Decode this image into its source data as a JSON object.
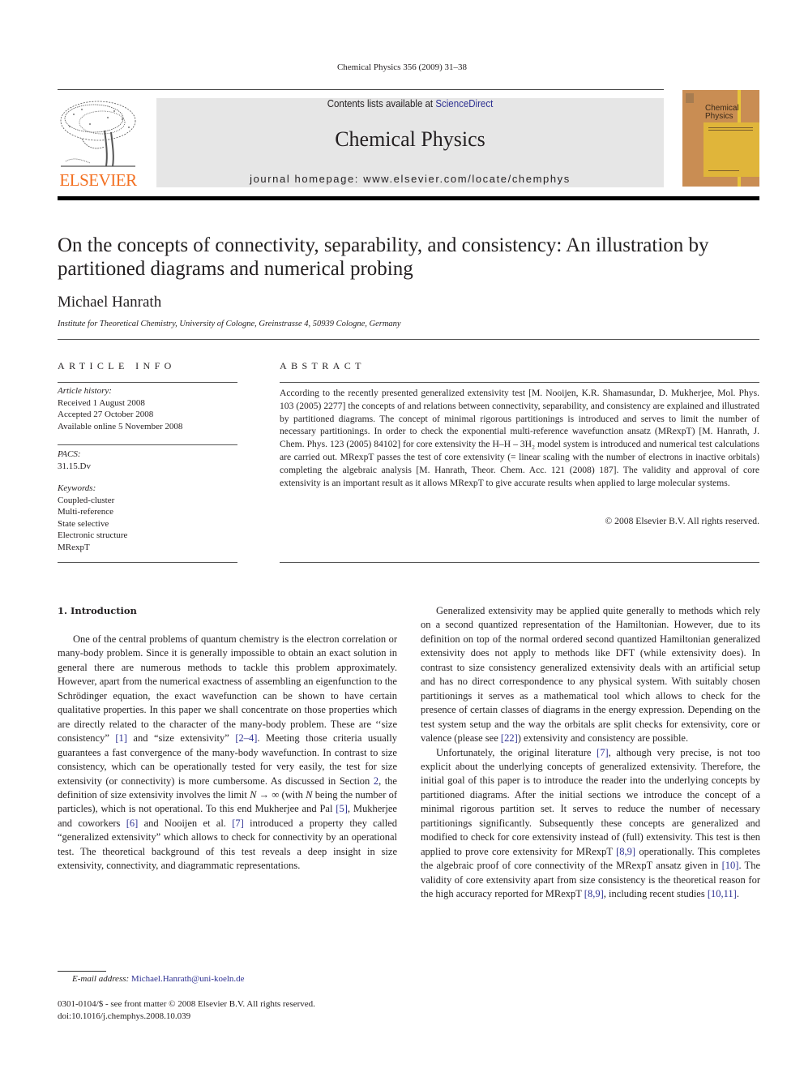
{
  "header": {
    "citation": "Chemical Physics 356 (2009) 31–38",
    "contents_prefix": "Contents lists available at ",
    "contents_link": "ScienceDirect",
    "journal_title": "Chemical Physics",
    "homepage": "journal homepage: www.elsevier.com/locate/chemphys",
    "publisher_logo_text": "ELSEVIER",
    "cover_title_line1": "Chemical",
    "cover_title_line2": "Physics",
    "colors": {
      "elsevier_orange": "#f37021",
      "link_blue": "#2e3192",
      "cover_brown": "#c98d53",
      "cover_yellow": "#e0b53a",
      "grey_box": "#e6e6e6"
    }
  },
  "article": {
    "title": "On the concepts of connectivity, separability, and consistency: An illustration by partitioned diagrams and numerical probing",
    "author": "Michael Hanrath",
    "affiliation": "Institute for Theoretical Chemistry, University of Cologne, Greinstrasse 4, 50939 Cologne, Germany"
  },
  "article_info": {
    "heading": "ARTICLE INFO",
    "history_label": "Article history:",
    "history": [
      "Received 1 August 2008",
      "Accepted 27 October 2008",
      "Available online 5 November 2008"
    ],
    "pacs_label": "PACS:",
    "pacs": "31.15.Dv",
    "keywords_label": "Keywords:",
    "keywords": [
      "Coupled-cluster",
      "Multi-reference",
      "State selective",
      "Electronic structure",
      "MRexpT"
    ]
  },
  "abstract": {
    "heading": "ABSTRACT",
    "text": "According to the recently presented generalized extensivity test [M. Nooijen, K.R. Shamasundar, D. Mukherjee, Mol. Phys. 103 (2005) 2277] the concepts of and relations between connectivity, separability, and consistency are explained and illustrated by partitioned diagrams. The concept of minimal rigorous partitionings is introduced and serves to limit the number of necessary partitionings. In order to check the exponential multi-reference wavefunction ansatz (MRexpT) [M. Hanrath, J. Chem. Phys. 123 (2005) 84102] for core extensivity the H–H – 3H₂ model system is introduced and numerical test calculations are carried out. MRexpT passes the test of core extensivity (= linear scaling with the number of electrons in inactive orbitals) completing the algebraic analysis [M. Hanrath, Theor. Chem. Acc. 121 (2008) 187]. The validity and approval of core extensivity is an important result as it allows MRexpT to give accurate results when applied to large molecular systems.",
    "copyright": "© 2008 Elsevier B.V. All rights reserved."
  },
  "body": {
    "section_heading": "1. Introduction",
    "left_paragraphs": [
      [
        {
          "t": "One of the central problems of quantum chemistry is the electron correlation or many-body problem. Since it is generally impossible to obtain an exact solution in general there are numerous methods to tackle this problem approximately. However, apart from the numerical exactness of assembling an eigenfunction to the Schrödinger equation, the exact wavefunction can be shown to have certain qualitative properties. In this paper we shall concentrate on those properties which are directly related to the character of the many-body problem. These are ‘‘size consistency” "
        },
        {
          "t": "[1]",
          "link": true
        },
        {
          "t": " and “size extensivity” "
        },
        {
          "t": "[2–4]",
          "link": true
        },
        {
          "t": ". Meeting those criteria usually guarantees a fast convergence of the many-body wavefunction. In contrast to size consistency, which can be operationally tested for very easily, the test for size extensivity (or connectivity) is more cumbersome. As discussed in Section "
        },
        {
          "t": "2",
          "link": true
        },
        {
          "t": ", the definition of size extensivity involves the limit "
        },
        {
          "t": "N → ∞",
          "ital": true
        },
        {
          "t": " (with "
        },
        {
          "t": "N",
          "ital": true
        },
        {
          "t": " being the number of particles), which is not operational. To this end Mukherjee and Pal "
        },
        {
          "t": "[5]",
          "link": true
        },
        {
          "t": ", Mukherjee and coworkers "
        },
        {
          "t": "[6]",
          "link": true
        },
        {
          "t": " and Nooijen et al. "
        },
        {
          "t": "[7]",
          "link": true
        },
        {
          "t": " introduced a property they called “generalized extensivity” which allows to check for connectivity by an operational test. The theoretical background of this test reveals a deep insight in size extensivity, connectivity, and diagrammatic representations."
        }
      ]
    ],
    "right_paragraphs": [
      [
        {
          "t": "Generalized extensivity may be applied quite generally to methods which rely on a second quantized representation of the Hamiltonian. However, due to its definition on top of the normal ordered second quantized Hamiltonian generalized extensivity does not apply to methods like DFT (while extensivity does). In contrast to size consistency generalized extensivity deals with an artificial setup and has no direct correspondence to any physical system. With suitably chosen partitionings it serves as a mathematical tool which allows to check for the presence of certain classes of diagrams in the energy expression. Depending on the test system setup and the way the orbitals are split checks for extensivity, core or valence (please see "
        },
        {
          "t": "[22]",
          "link": true
        },
        {
          "t": ") extensivity and consistency are possible."
        }
      ],
      [
        {
          "t": "Unfortunately, the original literature "
        },
        {
          "t": "[7]",
          "link": true
        },
        {
          "t": ", although very precise, is not too explicit about the underlying concepts of generalized extensivity. Therefore, the initial goal of this paper is to introduce the reader into the underlying concepts by partitioned diagrams. After the initial sections we introduce the concept of a minimal rigorous partition set. It serves to reduce the number of necessary partitionings significantly. Subsequently these concepts are generalized and modified to check for core extensivity instead of (full) extensivity. This test is then applied to prove core extensivity for MRexpT "
        },
        {
          "t": "[8,9]",
          "link": true
        },
        {
          "t": " operationally. This completes the algebraic proof of core connectivity of the MRexpT ansatz given in "
        },
        {
          "t": "[10]",
          "link": true
        },
        {
          "t": ". The validity of core extensivity apart from size consistency is the theoretical reason for the high accuracy reported for MRexpT "
        },
        {
          "t": "[8,9]",
          "link": true
        },
        {
          "t": ", including recent studies "
        },
        {
          "t": "[10,11]",
          "link": true
        },
        {
          "t": "."
        }
      ]
    ]
  },
  "footnotes": {
    "email_label": "E-mail address: ",
    "email": "Michael.Hanrath@uni-koeln.de",
    "issn_line": "0301-0104/$ - see front matter © 2008 Elsevier B.V. All rights reserved.",
    "doi_line": "doi:10.1016/j.chemphys.2008.10.039"
  }
}
